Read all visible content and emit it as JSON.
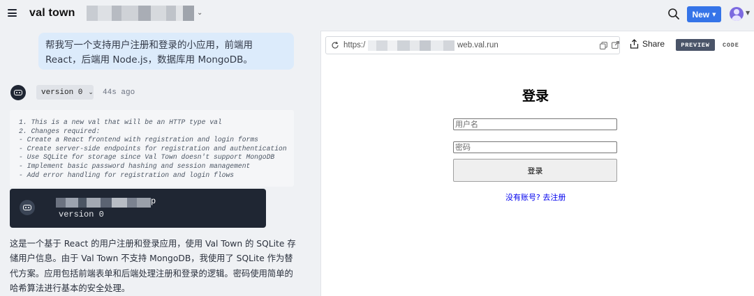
{
  "app": {
    "logo_text": "val town"
  },
  "header": {
    "new_button_label": "New"
  },
  "chat": {
    "prompt": "帮我写一个支持用户注册和登录的小应用，前端用 React，后端用 Node.js，数据库用 MongoDB。",
    "version_select_label": "version 0",
    "timestamp": "44s ago",
    "plan_text": "1. This is a new val that will be an HTTP type val\n2. Changes required:\n- Create a React frontend with registration and login forms\n- Create server-side endpoints for registration and authentication\n- Use SQLite for storage since Val Town doesn't support MongoDB\n- Implement basic password hashing and session management\n- Add error handling for registration and login flows",
    "card_name_suffix": "p",
    "card_version": "version 0",
    "description": "这是一个基于 React 的用户注册和登录应用，使用 Val Town 的 SQLite 存储用户信息。由于 Val Town 不支持 MongoDB，我使用了 SQLite 作为替代方案。应用包括前端表单和后端处理注册和登录的逻辑。密码使用简单的哈希算法进行基本的安全处理。"
  },
  "preview": {
    "url_prefix": "https:/",
    "url_suffix": "web.val.run",
    "share_label": "Share",
    "preview_tab_label": "PREVIEW",
    "code_tab_label": "CODE",
    "app_title": "登录",
    "username_placeholder": "用户名",
    "password_placeholder": "密码",
    "login_button_label": "登录",
    "register_link_text": "没有账号? 去注册"
  },
  "colors": {
    "accent": "#3574e8",
    "prompt_bubble": "#dcebfb",
    "dark_card": "#1f2633",
    "preview_tab": "#4a5468"
  },
  "icons": [
    "menu-icon",
    "chevron-down-icon",
    "search-icon",
    "user-avatar-icon",
    "bot-icon",
    "reload-icon",
    "copy-icon",
    "external-link-icon",
    "share-icon"
  ]
}
